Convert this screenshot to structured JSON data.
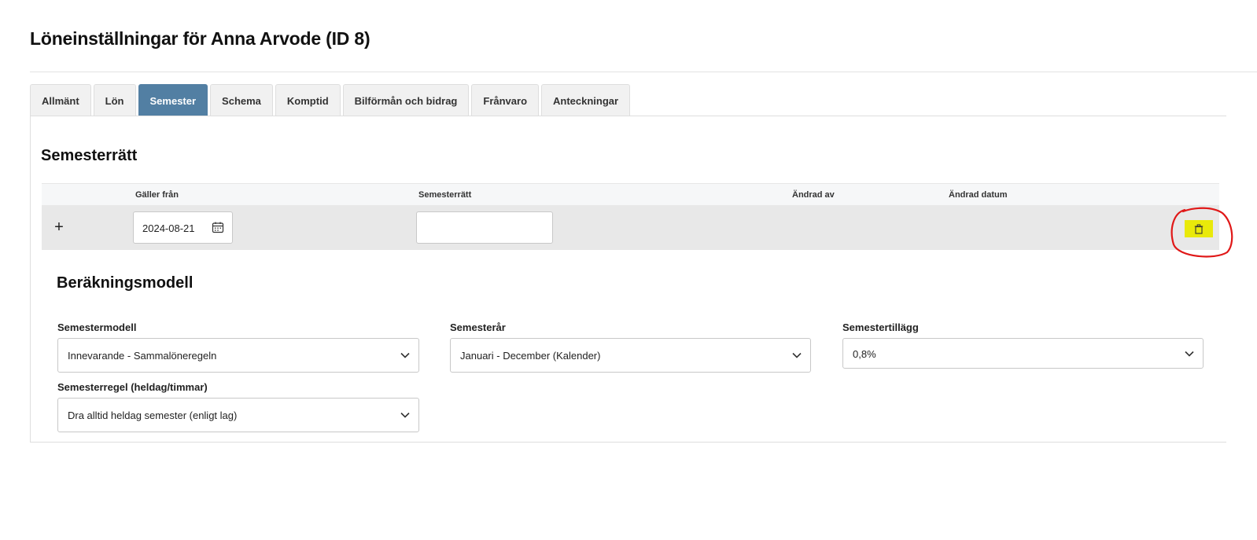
{
  "page": {
    "title": "Löneinställningar för Anna Arvode (ID 8)"
  },
  "tabs": [
    {
      "label": "Allmänt",
      "active": false
    },
    {
      "label": "Lön",
      "active": false
    },
    {
      "label": "Semester",
      "active": true
    },
    {
      "label": "Schema",
      "active": false
    },
    {
      "label": "Komptid",
      "active": false
    },
    {
      "label": "Bilförmån och bidrag",
      "active": false
    },
    {
      "label": "Frånvaro",
      "active": false
    },
    {
      "label": "Anteckningar",
      "active": false
    }
  ],
  "semesterratt": {
    "title": "Semesterrätt",
    "columns": {
      "galler_fran": "Gäller från",
      "semesterratt": "Semesterrätt",
      "andrad_av": "Ändrad av",
      "andrad_datum": "Ändrad datum"
    },
    "row": {
      "add_icon": "plus-icon",
      "date": "2024-08-21",
      "calendar_icon": "calendar-icon",
      "semesterratt_value": "",
      "delete_icon": "trash-icon"
    }
  },
  "berakningsmodell": {
    "title": "Beräkningsmodell",
    "semestermodell": {
      "label": "Semestermodell",
      "value": "Innevarande - Sammalöneregeln"
    },
    "semesterar": {
      "label": "Semesterår",
      "value": "Januari - December (Kalender)"
    },
    "semestertillagg": {
      "label": "Semestertillägg",
      "value": "0,8%"
    },
    "semesterregel": {
      "label": "Semesterregel (heldag/timmar)",
      "value": "Dra alltid heldag semester (enligt lag)"
    }
  },
  "colors": {
    "active_tab": "#527fa3",
    "highlight": "#e9e90a",
    "annotation": "#e01818"
  }
}
